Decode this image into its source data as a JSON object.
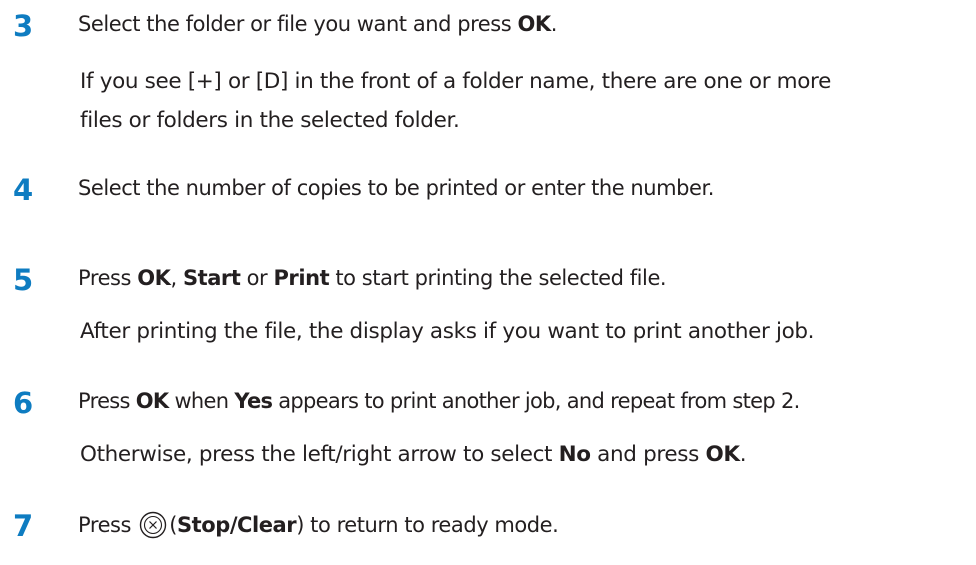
{
  "steps": [
    {
      "number": "3",
      "line": [
        "Select the folder or file you want and press ",
        "OK",
        "."
      ],
      "sub": [
        "If you see [+] or [D] in the front of a folder name, there are one or more",
        "files or folders in the selected folder."
      ]
    },
    {
      "number": "4",
      "line": [
        "Select the number of copies to be printed or enter the number."
      ]
    },
    {
      "number": "5",
      "line": [
        "Press ",
        "OK",
        ", ",
        "Start",
        " or ",
        "Print",
        " to start printing the selected file."
      ],
      "sub": [
        "After printing the file, the display asks if you want to print another job."
      ]
    },
    {
      "number": "6",
      "line": [
        "Press ",
        "OK",
        " when ",
        "Yes",
        " appears to print another job, and repeat from step 2."
      ],
      "sub": [
        [
          "Otherwise, press the left/right arrow to select ",
          "No",
          " and press ",
          "OK",
          "."
        ]
      ]
    },
    {
      "number": "7",
      "line": [
        "Press ",
        "(",
        "Stop/Clear",
        ") to return to ready mode."
      ],
      "icon": "stop-clear-icon"
    }
  ],
  "colors": {
    "step_number": "#0e7cc1",
    "text": "#231f20"
  }
}
